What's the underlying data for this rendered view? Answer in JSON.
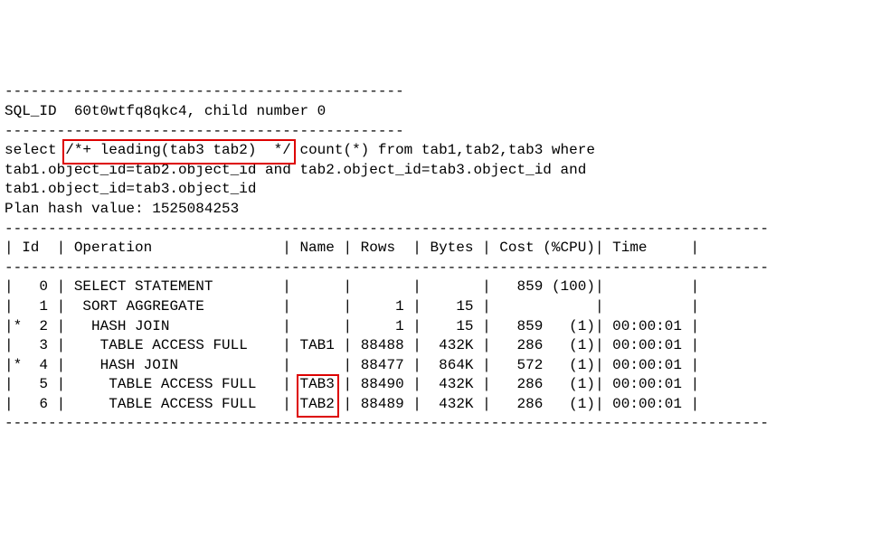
{
  "sep_line": "----------------------------------------------",
  "sql_id_line": "SQL_ID  60t0wtfq8qkc4, child number 0",
  "sql_prefix": "select ",
  "sql_hint": "/*+ leading(tab3 tab2)  */",
  "sql_rest_line1": " count(*) from tab1,tab2,tab3 where",
  "sql_line2": "tab1.object_id=tab2.object_id and tab2.object_id=tab3.object_id and",
  "sql_line3": "tab1.object_id=tab3.object_id",
  "plan_hash_line": "Plan hash value: 1525084253",
  "table_sep": "----------------------------------------------------------------------------------------",
  "table_header": "| Id  | Operation               | Name | Rows  | Bytes | Cost (%CPU)| Time     |",
  "rows": [
    {
      "id": "0",
      "star": " ",
      "op": "SELECT STATEMENT        ",
      "name": "    ",
      "rows": "     ",
      "bytes": "     ",
      "cost": "  859 (100)",
      "time": "        "
    },
    {
      "id": "1",
      "star": " ",
      "op": " SORT AGGREGATE         ",
      "name": "    ",
      "rows": "    1",
      "bytes": "   15",
      "cost": "           ",
      "time": "        "
    },
    {
      "id": "2",
      "star": "*",
      "op": "  HASH JOIN             ",
      "name": "    ",
      "rows": "    1",
      "bytes": "   15",
      "cost": "  859   (1)",
      "time": "00:00:01"
    },
    {
      "id": "3",
      "star": " ",
      "op": "   TABLE ACCESS FULL    ",
      "name": "TAB1",
      "rows": "88488",
      "bytes": " 432K",
      "cost": "  286   (1)",
      "time": "00:00:01"
    },
    {
      "id": "4",
      "star": "*",
      "op": "   HASH JOIN            ",
      "name": "    ",
      "rows": "88477",
      "bytes": " 864K",
      "cost": "  572   (1)",
      "time": "00:00:01"
    },
    {
      "id": "5",
      "star": " ",
      "op": "    TABLE ACCESS FULL   ",
      "name": "TAB3",
      "rows": "88490",
      "bytes": " 432K",
      "cost": "  286   (1)",
      "time": "00:00:01"
    },
    {
      "id": "6",
      "star": " ",
      "op": "    TABLE ACCESS FULL   ",
      "name": "TAB2",
      "rows": "88489",
      "bytes": " 432K",
      "cost": "  286   (1)",
      "time": "00:00:01"
    }
  ],
  "highlight_hint": true,
  "highlight_names_rows": [
    5,
    6
  ]
}
